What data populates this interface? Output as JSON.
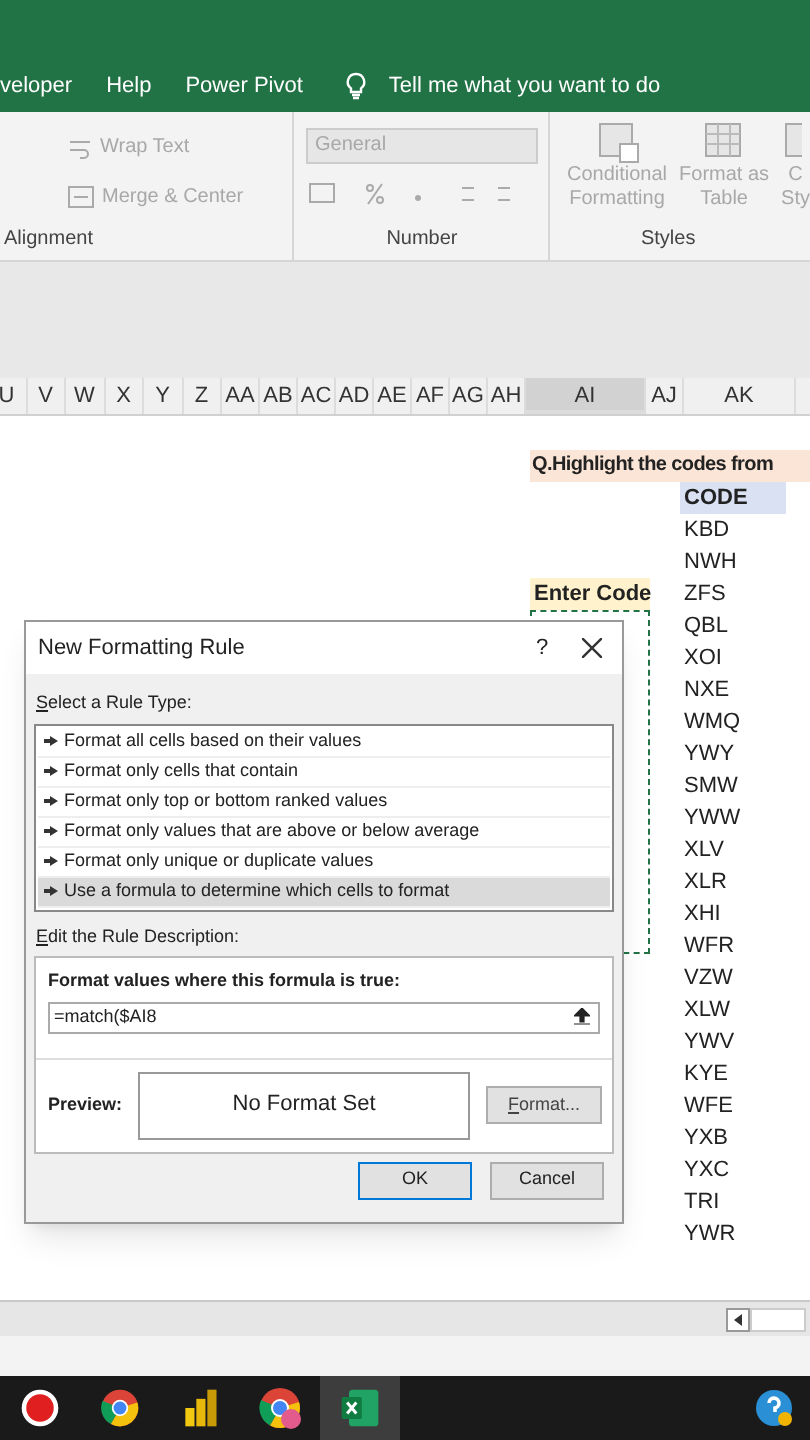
{
  "menu": [
    "veloper",
    "Help",
    "Power Pivot"
  ],
  "tell_me": "Tell me what you want to do",
  "ribbon": {
    "wrap_text": "Wrap Text",
    "merge_center": "Merge & Center",
    "alignment": "Alignment",
    "number_format": "General",
    "number": "Number",
    "conditional_formatting": [
      "Conditional",
      "Formatting"
    ],
    "format_as_table": [
      "Format as",
      "Table"
    ],
    "cell_styles": [
      "C",
      "Sty"
    ],
    "styles": "Styles"
  },
  "columns": [
    {
      "label": "U",
      "selected": false
    },
    {
      "label": "V",
      "selected": false
    },
    {
      "label": "W",
      "selected": false
    },
    {
      "label": "X",
      "selected": false
    },
    {
      "label": "Y",
      "selected": false
    },
    {
      "label": "Z",
      "selected": false
    },
    {
      "label": "AA",
      "selected": false
    },
    {
      "label": "AB",
      "selected": false
    },
    {
      "label": "AC",
      "selected": false
    },
    {
      "label": "AD",
      "selected": false
    },
    {
      "label": "AE",
      "selected": false
    },
    {
      "label": "AF",
      "selected": false
    },
    {
      "label": "AG",
      "selected": false
    },
    {
      "label": "AH",
      "selected": false
    },
    {
      "label": "AI",
      "selected": true
    },
    {
      "label": "AJ",
      "selected": false
    },
    {
      "label": "AK",
      "selected": false
    }
  ],
  "sheet": {
    "question": "Q.Highlight the codes from",
    "code_header": "CODE",
    "enter_code": "Enter Code",
    "codes": [
      "KBD",
      "NWH",
      "ZFS",
      "QBL",
      "XOI",
      "NXE",
      "WMQ",
      "YWY",
      "SMW",
      "YWW",
      "XLV",
      "XLR",
      "XHI",
      "WFR",
      "VZW",
      "XLW",
      "YWV",
      "KYE",
      "WFE",
      "YXB",
      "YXC",
      "TRI",
      "YWR"
    ]
  },
  "dialog": {
    "title": "New Formatting Rule",
    "help": "?",
    "select_label": "Select a Rule Type:",
    "rule_types": [
      {
        "label": "Format all cells based on their values",
        "selected": false
      },
      {
        "label": "Format only cells that contain",
        "selected": false
      },
      {
        "label": "Format only top or bottom ranked values",
        "selected": false
      },
      {
        "label": "Format only values that are above or below average",
        "selected": false
      },
      {
        "label": "Format only unique or duplicate values",
        "selected": false
      },
      {
        "label": "Use a formula to determine which cells to format",
        "selected": true
      }
    ],
    "edit_label": "Edit the Rule Description:",
    "formula_label": "Format values where this formula is true:",
    "formula": "=match($AI8",
    "preview_label": "Preview:",
    "preview": "No Format Set",
    "format_button": "Format...",
    "ok": "OK",
    "cancel": "Cancel"
  },
  "taskbar": [
    {
      "kind": "record",
      "selected": false
    },
    {
      "kind": "chrome",
      "selected": false
    },
    {
      "kind": "powerbi",
      "selected": false
    },
    {
      "kind": "chrome-profile",
      "selected": false
    },
    {
      "kind": "excel",
      "selected": true
    }
  ]
}
